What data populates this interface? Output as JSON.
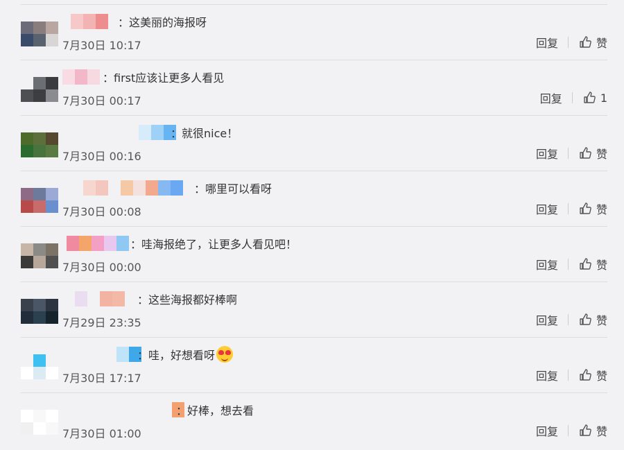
{
  "labels": {
    "reply": "回复",
    "like": "赞"
  },
  "comments": [
    {
      "text": "：这美丽的海报呀",
      "time": "7月30日 10:17",
      "likes": "赞",
      "avatar": [
        "#6b6b7a",
        "#8a7d7d",
        "#b9a6a1",
        "#3a4a6a",
        "#59626f",
        "#d8d5d5"
      ],
      "nick": [
        "#f7c8c8",
        "#f3b3b3",
        "#ee8d8d"
      ]
    },
    {
      "text": "：first应该让更多人看见",
      "time": "7月30日 00:17",
      "likes": "1",
      "avatar": [
        "#f2f2f5",
        "#6b6e73",
        "#3b3c40",
        "#4e4f52",
        "#3d3e40",
        "#8a8b90"
      ],
      "nick": [
        "#f9dbe3",
        "#f2b7c8",
        "#f7d9e2"
      ]
    },
    {
      "text": "：就很nice！",
      "time": "7月30日 00:16",
      "likes": "赞",
      "avatar": [
        "#4e6b2c",
        "#5d6f3a",
        "#55482e",
        "#2c6b2e",
        "#48733d",
        "#5a7a44"
      ],
      "nick": [
        "#d7ecfb",
        "#9fd1f7",
        "#66b4f2"
      ]
    },
    {
      "text": "：哪里可以看呀",
      "time": "7月30日 00:08",
      "likes": "赞",
      "avatar": [
        "#8e6a87",
        "#6e7a9c",
        "#9aa9d6",
        "#b94a4a",
        "#c86b6b",
        "#6a8fcf"
      ],
      "nick": [
        "#f7d6d0",
        "#f3c7bd",
        "#f2f2f5",
        "#f5c9a5",
        "#f5e0e0",
        "#f3a98e",
        "#86b9f2",
        "#6aa8f2"
      ]
    },
    {
      "text": "：哇海报绝了，让更多人看见吧！",
      "time": "7月30日 00:00",
      "likes": "赞",
      "avatar": [
        "#c7b6a8",
        "#8c8a87",
        "#7d7266",
        "#3b3a38",
        "#b7a79b",
        "#505050"
      ],
      "nick": [
        "#f08aa0",
        "#f3a56a",
        "#f49fc4",
        "#e9c8ef",
        "#8fc8f2"
      ]
    },
    {
      "text": "：这些海报都好棒啊",
      "time": "7月29日 23:35",
      "likes": "赞",
      "avatar": [
        "#39414d",
        "#4a5666",
        "#2b3440",
        "#1f2e3a",
        "#2c4150",
        "#15232d"
      ],
      "nick": [
        "#f2f2f5",
        "#eadcf1",
        "#f2f2f5",
        "#f3b3a3",
        "#f3b8a6"
      ]
    },
    {
      "text": "：哇，好想看呀",
      "time": "7月30日 17:17",
      "likes": "赞",
      "emoji": "heart-eyes",
      "avatar": [
        "#f2f2f5",
        "#3ec1f2",
        "#f2f2f5",
        "#ffffff",
        "#dcebf3",
        "#ffffff"
      ],
      "nick": [
        "#f2f2f5",
        "#bfe3f8",
        "#3ea8e8"
      ]
    },
    {
      "text": "：好棒，想去看",
      "time": "7月30日 01:00",
      "likes": "赞",
      "avatar": [
        "#ffffff",
        "#f8f8f8",
        "#ffffff",
        "#f0f0f0",
        "#ffffff",
        "#f8f8f8"
      ],
      "nick": [
        "#f2f2f5",
        "#f2a070"
      ]
    }
  ]
}
